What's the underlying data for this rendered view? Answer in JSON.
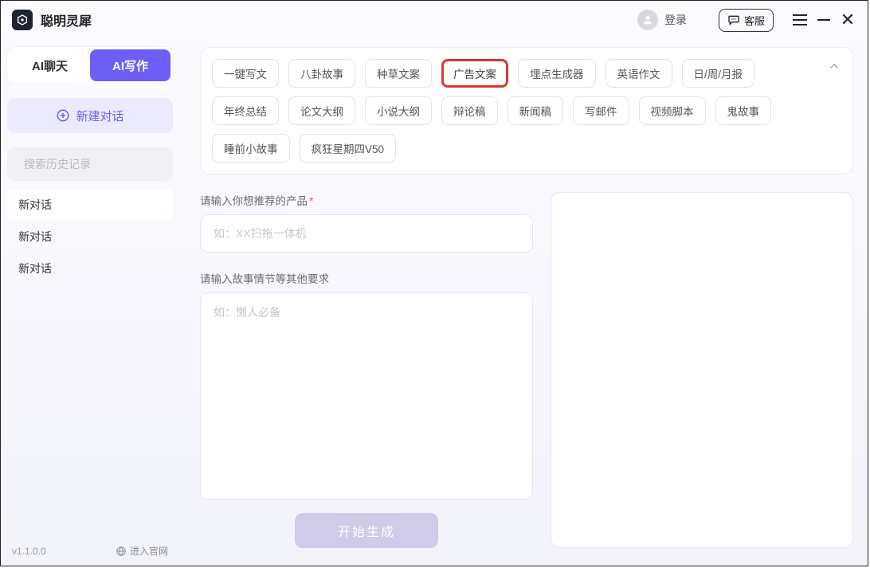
{
  "titlebar": {
    "app_name": "聪明灵犀",
    "login_label": "登录",
    "kefu_label": "客服"
  },
  "sidebar": {
    "tabs": {
      "chat": "AI聊天",
      "write": "AI写作"
    },
    "new_chat_label": "新建对话",
    "search_placeholder": "搜索历史记录",
    "history": [
      "新对话",
      "新对话",
      "新对话"
    ],
    "version": "v1.1.0.0",
    "enter_site_label": "进入官网"
  },
  "templates": {
    "row1": [
      "一键写文",
      "八卦故事",
      "种草文案",
      "广告文案",
      "埋点生成器",
      "英语作文",
      "日/周/月报",
      "年终总结"
    ],
    "row2": [
      "论文大纲",
      "小说大纲",
      "辩论稿",
      "新闻稿",
      "写邮件",
      "视频脚本",
      "鬼故事",
      "睡前小故事",
      "疯狂星期四V50"
    ],
    "highlighted": "广告文案"
  },
  "form": {
    "product_label": "请输入你想推荐的产品",
    "product_placeholder": "如：XX扫拖一体机",
    "detail_label": "请输入故事情节等其他要求",
    "detail_placeholder": "如：懒人必备",
    "generate_label": "开始生成"
  }
}
